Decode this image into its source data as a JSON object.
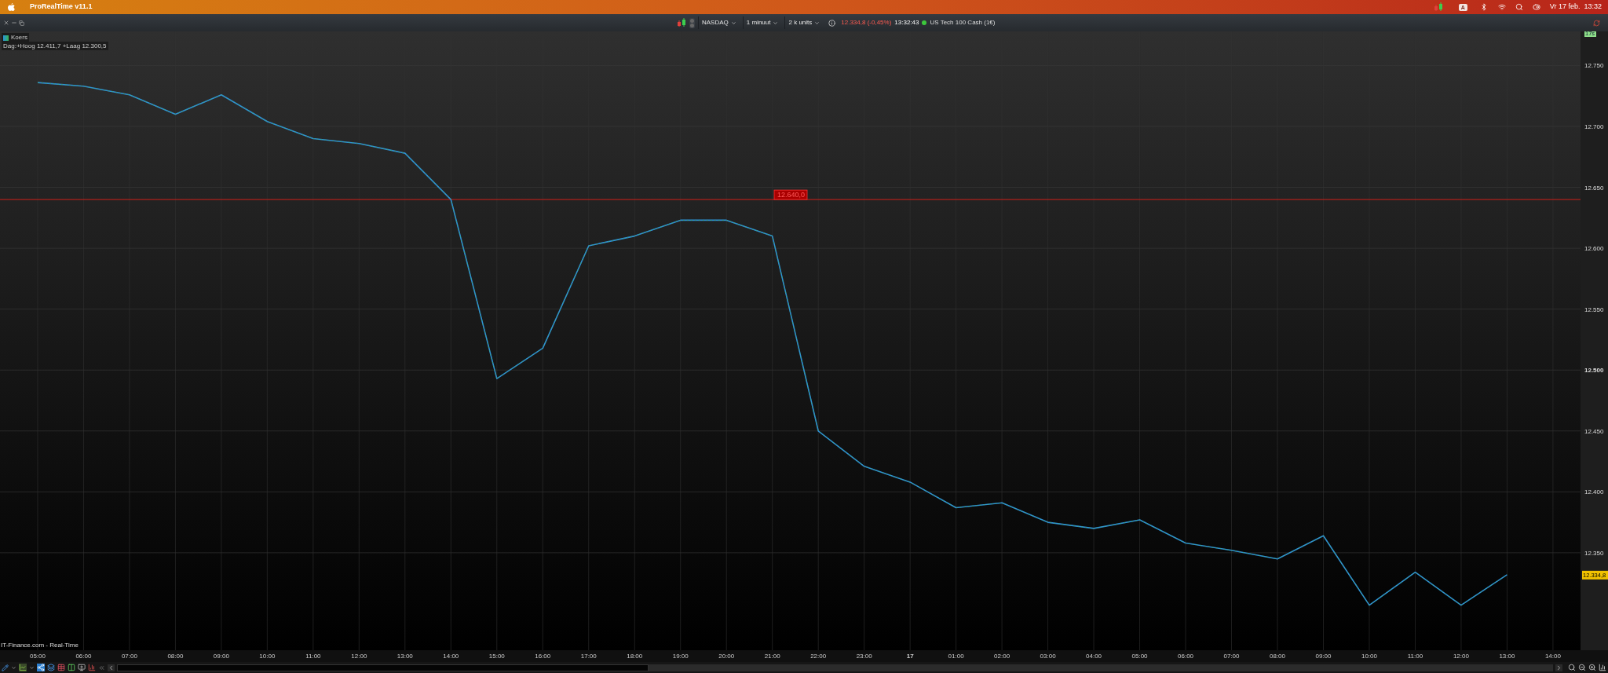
{
  "menu_bar": {
    "app_name": "ProRealTime v11.1",
    "clock": "Vr 17 feb.  13:32",
    "keyboard_badge": "A"
  },
  "toolbar": {
    "dropdowns": [
      {
        "label": "NASDAQ"
      },
      {
        "label": "1 minuut"
      },
      {
        "label": "2 k units"
      }
    ],
    "quote": "12.334,8 (-0,45%)",
    "time": "13:32:43",
    "connected": true,
    "instrument": "US Tech 100 Cash (1€)"
  },
  "legend": {
    "day_range": "Dag:+Hoog 12.411,7 +Laag 12.300,5"
  },
  "chart": {
    "countdown": "17s",
    "last_price": "12.334,8",
    "source": "IT-Finance.com - Real-Time",
    "chart_data": {
      "type": "line",
      "categories": [
        "05:00",
        "06:00",
        "07:00",
        "08:00",
        "09:00",
        "10:00",
        "11:00",
        "12:00",
        "13:00",
        "14:00",
        "15:00",
        "16:00",
        "17:00",
        "18:00",
        "19:00",
        "20:00",
        "21:00",
        "22:00",
        "23:00",
        "17",
        "01:00",
        "02:00",
        "03:00",
        "04:00",
        "05:00",
        "06:00",
        "07:00",
        "08:00",
        "09:00",
        "10:00",
        "11:00",
        "12:00",
        "13:00",
        "14:00"
      ],
      "series": [
        {
          "name": "Koers",
          "color": "#2f8fd8",
          "values": [
            12736,
            12733,
            12726,
            12710,
            12726,
            12704,
            12690,
            12686,
            12678,
            12640,
            12493,
            12518,
            12602,
            12610,
            12623,
            12623,
            12610,
            12450,
            12421,
            12408,
            12387,
            12391,
            12375,
            12370,
            12377,
            12358,
            12352,
            12345,
            12364,
            12307,
            12334,
            12307,
            12332,
            null
          ]
        }
      ],
      "ylim": [
        12270,
        12778
      ],
      "yticks": [
        {
          "value": 12350,
          "label": "12.350"
        },
        {
          "value": 12400,
          "label": "12.400"
        },
        {
          "value": 12450,
          "label": "12.450"
        },
        {
          "value": 12500,
          "label": "12.500"
        },
        {
          "value": 12550,
          "label": "12.550"
        },
        {
          "value": 12600,
          "label": "12.600"
        },
        {
          "value": 12650,
          "label": "12.650"
        },
        {
          "value": 12700,
          "label": "12.700"
        },
        {
          "value": 12750,
          "label": "12.750"
        }
      ],
      "grid": true,
      "ref_lines": [
        {
          "axis": "y",
          "value": 12640,
          "label": "12.640,0"
        }
      ]
    }
  }
}
